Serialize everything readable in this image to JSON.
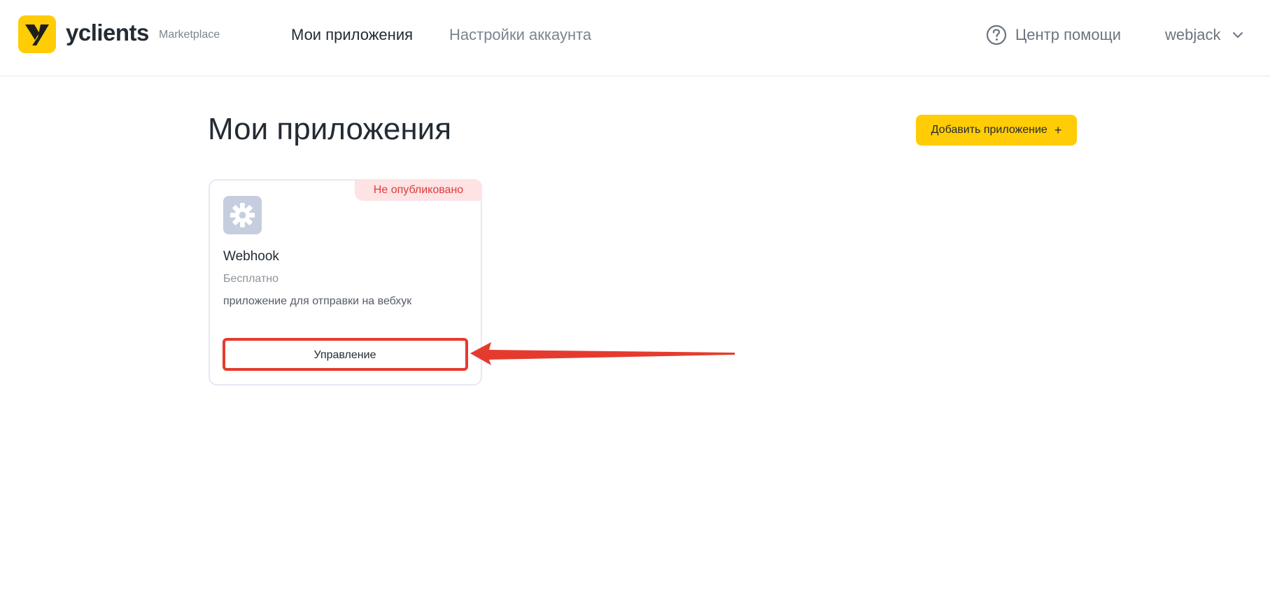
{
  "header": {
    "brand": "yclients",
    "brand_sub": "Marketplace",
    "nav": [
      {
        "label": "Мои приложения",
        "active": true
      },
      {
        "label": "Настройки аккаунта",
        "active": false
      }
    ],
    "help_label": "Центр помощи",
    "user_name": "webjack",
    "icons": {
      "logo": "yclients-logo-icon",
      "help": "question-circle-icon",
      "user_menu": "chevron-down-icon"
    }
  },
  "main": {
    "title": "Мои приложения",
    "add_button_label": "Добавить приложение",
    "add_button_icon": "+",
    "apps": [
      {
        "status_badge": "Не опубликовано",
        "icon": "gear-icon",
        "name": "Webhook",
        "price": "Бесплатно",
        "description": "приложение для отправки на вебхук",
        "manage_label": "Управление"
      }
    ]
  },
  "colors": {
    "accent": "#ffcc05",
    "badge_bg": "#fde3e4",
    "badge_text": "#e03b3b",
    "annotation": "#e53b2f"
  }
}
